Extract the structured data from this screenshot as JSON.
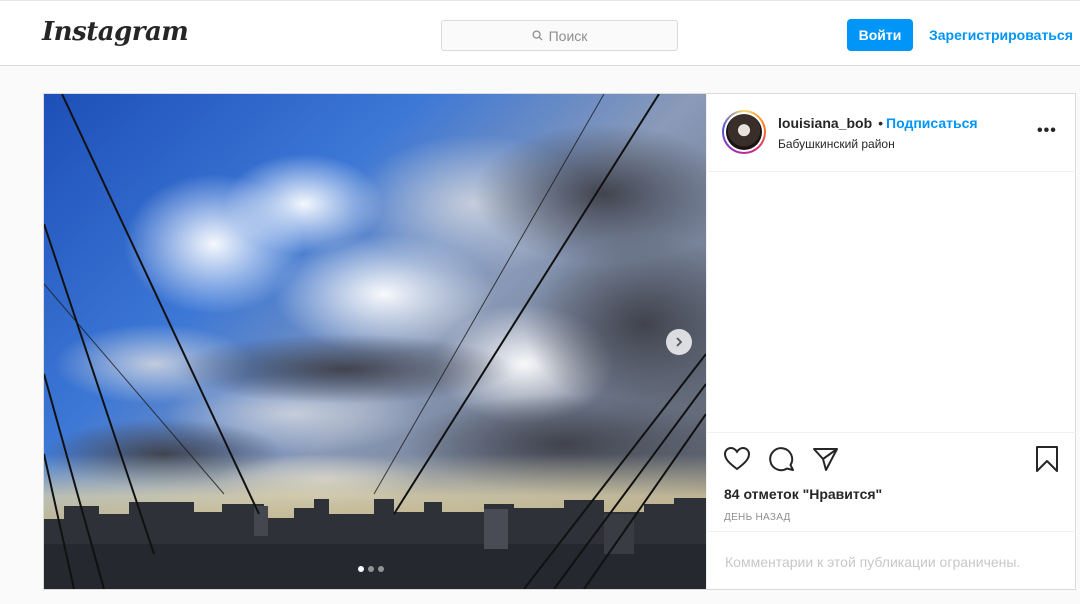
{
  "header": {
    "logo": "Instagram",
    "search_placeholder": "Поиск",
    "login_label": "Войти",
    "signup_label": "Зарегистрироваться"
  },
  "post": {
    "username": "louisiana_bob",
    "separator": "•",
    "follow_label": "Подписаться",
    "location": "Бабушкинский район",
    "more_label": "•••",
    "likes": "84 отметок \"Нравится\"",
    "time": "День назад",
    "comments_notice": "Комментарии к этой публикации ограничены.",
    "carousel_total": 3,
    "carousel_active": 1,
    "icons": [
      "heart-icon",
      "comment-icon",
      "share-icon",
      "bookmark-icon",
      "search-icon",
      "chevron-right-icon"
    ]
  },
  "colors": {
    "accent": "#0095f6",
    "border": "#dbdbdb",
    "text": "#262626",
    "muted": "#8e8e8e"
  }
}
